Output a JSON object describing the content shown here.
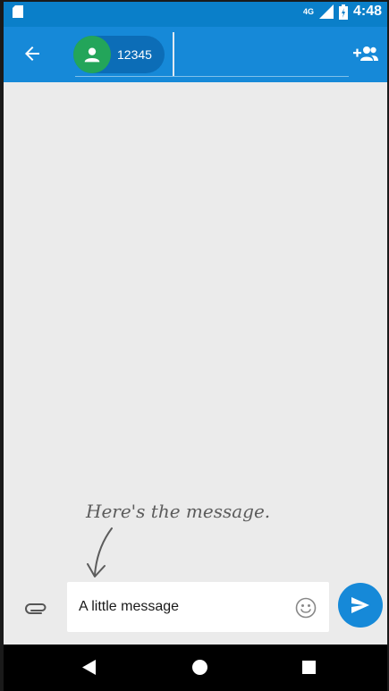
{
  "status_bar": {
    "network": "4G",
    "time": "4:48"
  },
  "app_bar": {
    "recipient_number": "12345",
    "back_icon": "arrow-left-icon",
    "add_people_icon": "group-add-icon",
    "avatar_color": "#23a55a"
  },
  "annotation": {
    "text": "Here's the message."
  },
  "compose": {
    "text": "A little message",
    "attach_icon": "paperclip-icon",
    "emoji_icon": "smiley-icon",
    "send_icon": "send-icon"
  },
  "nav_bar": {
    "back": "back-triangle-icon",
    "home": "home-circle-icon",
    "recents": "recents-square-icon"
  },
  "colors": {
    "primary": "#1689d8",
    "status_bar": "#0a7fc9",
    "background": "#ebebeb"
  }
}
